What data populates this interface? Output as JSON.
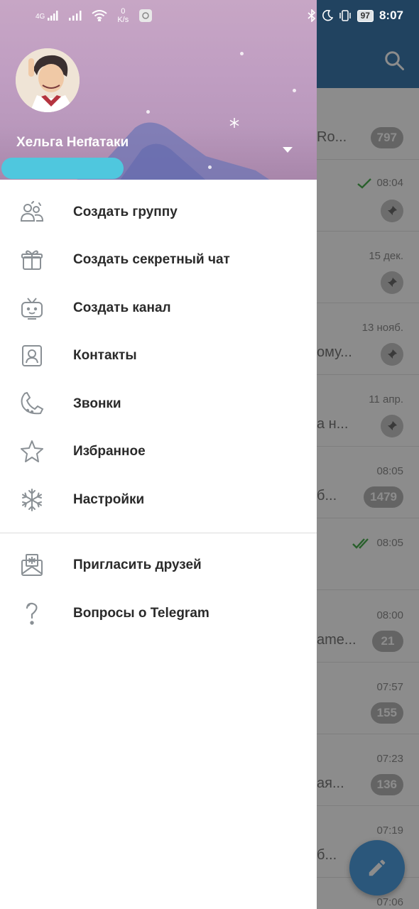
{
  "status_bar": {
    "network": "4G",
    "speed_value": "0",
    "speed_unit": "K/s",
    "battery": "97",
    "time": "8:07"
  },
  "drawer": {
    "user_name": "Хельга Непатаки",
    "menu_main": [
      {
        "label": "Создать группу",
        "icon": "group-icon"
      },
      {
        "label": "Создать секретный чат",
        "icon": "gift-lock-icon"
      },
      {
        "label": "Создать канал",
        "icon": "tv-channel-icon"
      },
      {
        "label": "Контакты",
        "icon": "contacts-icon"
      },
      {
        "label": "Звонки",
        "icon": "phone-icon"
      },
      {
        "label": "Избранное",
        "icon": "star-icon"
      },
      {
        "label": "Настройки",
        "icon": "snowflake-settings-icon"
      }
    ],
    "menu_secondary": [
      {
        "label": "Пригласить друзей",
        "icon": "invite-envelope-icon"
      },
      {
        "label": "Вопросы о Telegram",
        "icon": "question-icon"
      }
    ]
  },
  "chat_list": {
    "rows": [
      {
        "preview": "Ro...",
        "badge": "797"
      },
      {
        "time": "08:04",
        "read": "single"
      },
      {
        "time": "15 дек."
      },
      {
        "time": "13 нояб.",
        "preview": "ому..."
      },
      {
        "time": "11 апр.",
        "preview": "а н..."
      },
      {
        "time": "08:05",
        "preview": "б...",
        "badge": "1479"
      },
      {
        "time": "08:05",
        "read": "double"
      },
      {
        "time": "08:00",
        "preview": "ame...",
        "badge": "21"
      },
      {
        "time": "07:57",
        "badge": "155"
      },
      {
        "time": "07:23",
        "preview": "ая...",
        "badge": "136"
      },
      {
        "time": "07:19",
        "preview": "б..."
      },
      {
        "time": "07:06"
      }
    ]
  },
  "colors": {
    "header_blue": "#3d7bb0",
    "fab_blue": "#4f9fe0",
    "check_green": "#4caf50",
    "phone_redaction": "#4fc7de"
  }
}
